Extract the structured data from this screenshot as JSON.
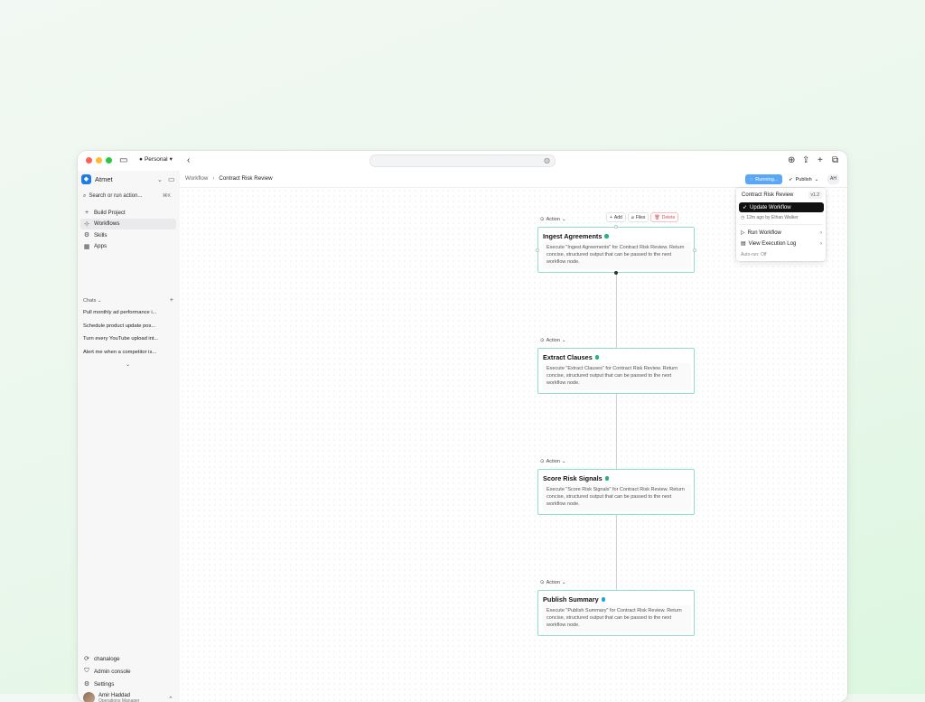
{
  "browser": {
    "profile": "Personal"
  },
  "sidebar": {
    "brand": "Atmet",
    "search_placeholder": "Search or run action...",
    "search_shortcut": "⌘K",
    "nav": [
      {
        "label": "Build Project",
        "icon": "plus-icon"
      },
      {
        "label": "Workflows",
        "icon": "workflow-icon"
      },
      {
        "label": "Skills",
        "icon": "skills-icon"
      },
      {
        "label": "Apps",
        "icon": "apps-icon"
      }
    ],
    "chats_label": "Chats",
    "chats": [
      "Pull monthly ad performance i...",
      "Schedule product update pos...",
      "Turn every YouTube upload int...",
      "Alert me when a competitor is..."
    ],
    "bottom_nav": [
      {
        "label": "chanaloge",
        "icon": "refresh-icon"
      },
      {
        "label": "Admin console",
        "icon": "admin-icon"
      },
      {
        "label": "Settings",
        "icon": "gear-icon"
      }
    ],
    "user": {
      "name": "Amir Haddad",
      "role": "Operations Manager"
    }
  },
  "header": {
    "breadcrumb_root": "Workflow",
    "breadcrumb_current": "Contract Risk Review",
    "running_label": "Running...",
    "publish_label": "Publish",
    "initials": "AH"
  },
  "toolbar": {
    "add_label": "Add",
    "files_label": "Files",
    "delete_label": "Delete"
  },
  "nodes": [
    {
      "tag": "Action",
      "title": "Ingest Agreements",
      "status_color": "#22b573",
      "description": "Execute \"Ingest Agreements\" for Contract Risk Review. Return concise, structured output that can be passed to the next workflow node."
    },
    {
      "tag": "Action",
      "title": "Extract Clauses",
      "status_color": "#22b573",
      "description": "Execute \"Extract Clauses\" for Contract Risk Review. Return concise, structured output that can be passed to the next workflow node."
    },
    {
      "tag": "Action",
      "title": "Score Risk Signals",
      "status_color": "#22b573",
      "description": "Execute \"Score Risk Signals\" for Contract Risk Review. Return concise, structured output that can be passed to the next workflow node."
    },
    {
      "tag": "Action",
      "title": "Publish Summary",
      "status_color": "#1fa3d8",
      "description": "Execute \"Publish Summary\" for Contract Risk Review. Return concise, structured output that can be passed to the next workflow node."
    }
  ],
  "dropdown": {
    "title": "Contract Risk Review",
    "version": "v1.2",
    "primary_label": "Update Workflow",
    "meta": "12m ago by Ethan Walker",
    "run_label": "Run Workflow",
    "log_label": "View Execution Log",
    "auto_run": "Auto-run: Off"
  },
  "colors": {
    "node_border": "#8fdfca",
    "running_badge": "#5aa8f3",
    "brand": "#1f7be5"
  }
}
